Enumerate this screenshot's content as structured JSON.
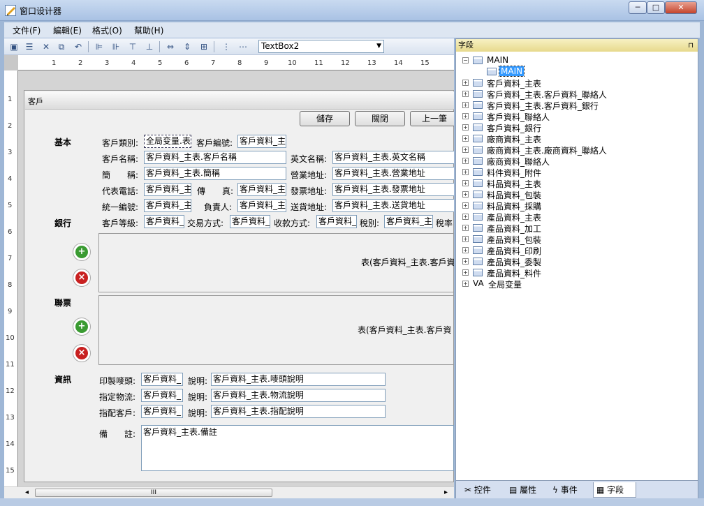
{
  "window": {
    "title": "窗口设计器",
    "min_label": "─",
    "max_label": "□",
    "close_label": "✕"
  },
  "menu": [
    {
      "label": "文件(F)"
    },
    {
      "label": "編輯(E)"
    },
    {
      "label": "格式(O)"
    },
    {
      "label": "幫助(H)"
    }
  ],
  "toolbar": {
    "object_select_value": "TextBox2"
  },
  "ruler": {
    "top": [
      "1",
      "2",
      "3",
      "4",
      "5",
      "6",
      "7",
      "8",
      "9",
      "10",
      "11",
      "12",
      "13",
      "14",
      "15"
    ],
    "left": [
      "1",
      "2",
      "3",
      "4",
      "5",
      "6",
      "7",
      "8",
      "9",
      "10",
      "11",
      "12",
      "13",
      "14",
      "15"
    ]
  },
  "form": {
    "caption": "客戶",
    "buttons": {
      "save": "儲存",
      "close": "關閉",
      "prev": "上一筆"
    },
    "sections": {
      "basic": "基本",
      "bank": "銀行",
      "contact": "聯票",
      "info": "資訊"
    },
    "fields": {
      "customer_type_label": "客戶類別:",
      "customer_type_value": "全局变量.表",
      "customer_id_label": "客戶編號:",
      "customer_id_value": "客戶資料_主",
      "customer_name_label": "客戶名稱:",
      "customer_name_value": "客戶資料_主表.客戶名稱",
      "english_name_label": "英文名稱:",
      "english_name_value": "客戶資料_主表.英文名稱",
      "short_name_label": "簡　　稱:",
      "short_name_value": "客戶資料_主表.簡稱",
      "business_addr_label": "營業地址:",
      "business_addr_value": "客戶資料_主表.營業地址",
      "phone_label": "代表電話:",
      "phone_value": "客戶資料_主",
      "fax_label": "傳　　真:",
      "fax_value": "客戶資料_主",
      "invoice_addr_label": "發票地址:",
      "invoice_addr_value": "客戶資料_主表.發票地址",
      "tax_id_label": "統一編號:",
      "tax_id_value": "客戶資料_主",
      "owner_label": "負責人:",
      "owner_value": "客戶資料_主",
      "delivery_addr_label": "送貨地址:",
      "delivery_addr_value": "客戶資料_主表.送貨地址",
      "level_label": "客戶等級:",
      "level_value": "客戶資料_",
      "trade_label": "交易方式:",
      "trade_value": "客戶資料_",
      "payment_label": "收款方式:",
      "payment_value": "客戶資料_",
      "tax_type_label": "稅別:",
      "tax_type_value": "客戶資料_主",
      "tax_rate_label": "稅率"
    },
    "grid_bank_text": "表(客戶資料_主表.客戶資",
    "grid_contact_text": "表(客戶資料_主表.客戶資",
    "info": {
      "mark_label": "印製嘜頭:",
      "mark_value": "客戶資料_",
      "mark_desc_label": "說明:",
      "mark_desc_value": "客戶資料_主表.嘜頭說明",
      "logistics_label": "指定物流:",
      "logistics_value": "客戶資料_",
      "logistics_desc_label": "說明:",
      "logistics_desc_value": "客戶資料_主表.物流說明",
      "dist_label": "指配客戶:",
      "dist_value": "客戶資料_",
      "dist_desc_label": "說明:",
      "dist_desc_value": "客戶資料_主表.指配說明",
      "remark_label": "備　　註:",
      "remark_value": "客戶資料_主表.備註"
    },
    "add_icon": "+",
    "del_icon": "×"
  },
  "scroll": {
    "thumb_label": "III",
    "left_arrow": "◂",
    "right_arrow": "▸"
  },
  "panel": {
    "title": "字段",
    "pin": "⊓",
    "tree": [
      {
        "label": "MAIN",
        "level": 0
      },
      {
        "label": "MAIN",
        "level": 1
      },
      {
        "label": "客戶資料_主表",
        "level": 0
      },
      {
        "label": "客戶資料_主表.客戶資料_聯絡人",
        "level": 0
      },
      {
        "label": "客戶資料_主表.客戶資料_銀行",
        "level": 0
      },
      {
        "label": "客戶資料_聯絡人",
        "level": 0
      },
      {
        "label": "客戶資料_銀行",
        "level": 0
      },
      {
        "label": "廠商資料_主表",
        "level": 0
      },
      {
        "label": "廠商資料_主表.廠商資料_聯絡人",
        "level": 0
      },
      {
        "label": "廠商資料_聯絡人",
        "level": 0
      },
      {
        "label": "料件資料_附件",
        "level": 0
      },
      {
        "label": "料品資料_主表",
        "level": 0
      },
      {
        "label": "料品資料_包裝",
        "level": 0
      },
      {
        "label": "料品資料_採購",
        "level": 0
      },
      {
        "label": "產品資料_主表",
        "level": 0
      },
      {
        "label": "產品資料_加工",
        "level": 0
      },
      {
        "label": "產品資料_包裝",
        "level": 0
      },
      {
        "label": "產品資料_印刷",
        "level": 0
      },
      {
        "label": "產品資料_委製",
        "level": 0
      },
      {
        "label": "產品資料_料件",
        "level": 0
      },
      {
        "label": "全局变量",
        "level": 0,
        "prefix": "VA"
      }
    ],
    "tabs": [
      {
        "label": "控件"
      },
      {
        "label": "屬性"
      },
      {
        "label": "事件"
      },
      {
        "label": "字段"
      }
    ]
  }
}
